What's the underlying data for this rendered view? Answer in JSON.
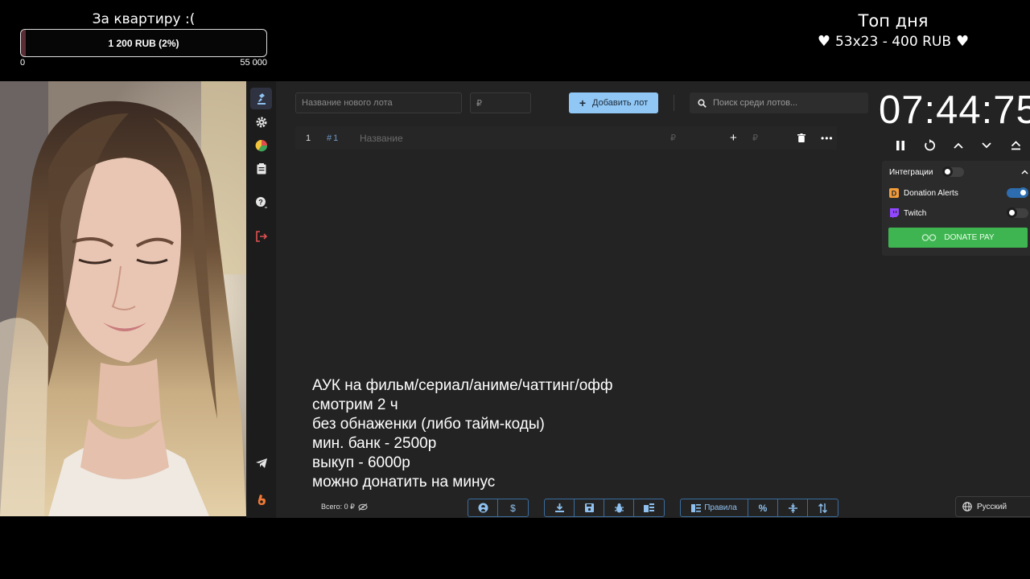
{
  "goal": {
    "title": "За квартиру :(",
    "progress_label": "1 200 RUB (2%)",
    "progress_percent": 2,
    "min": "0",
    "max": "55 000"
  },
  "top_day": {
    "title": "Топ дня",
    "entry": "53x23 - 400 RUB"
  },
  "toolbar": {
    "new_lot_placeholder": "Название нового лота",
    "amount_placeholder": "₽",
    "add_label": "Добавить лот",
    "search_placeholder": "Поиск среди лотов..."
  },
  "lots": [
    {
      "number": "1",
      "id": "1",
      "name_placeholder": "Название",
      "amount": "₽",
      "add_amount": "₽"
    }
  ],
  "rules_text": [
    "АУК на фильм/сериал/аниме/чаттинг/офф",
    "смотрим 2 ч",
    "без обнаженки (либо тайм-коды)",
    "мин. банк - 2500р",
    "выкуп - 6000р",
    "можно донатить на минус"
  ],
  "footer": {
    "total": "Всего: 0 ₽",
    "rules_button": "Правила",
    "language": "Русский"
  },
  "timer": {
    "display": "07:44:75"
  },
  "integrations": {
    "title": "Интеграции",
    "enabled": false,
    "items": [
      {
        "name": "Donation Alerts",
        "enabled": true
      },
      {
        "name": "Twitch",
        "enabled": false
      }
    ],
    "donate_pay_label": "DONATE PAY"
  },
  "colors": {
    "accent": "#90c7f5",
    "background": "#232323",
    "sidebar": "#1c1c1c",
    "donate_pay": "#3fb551",
    "logout": "#e05050"
  }
}
